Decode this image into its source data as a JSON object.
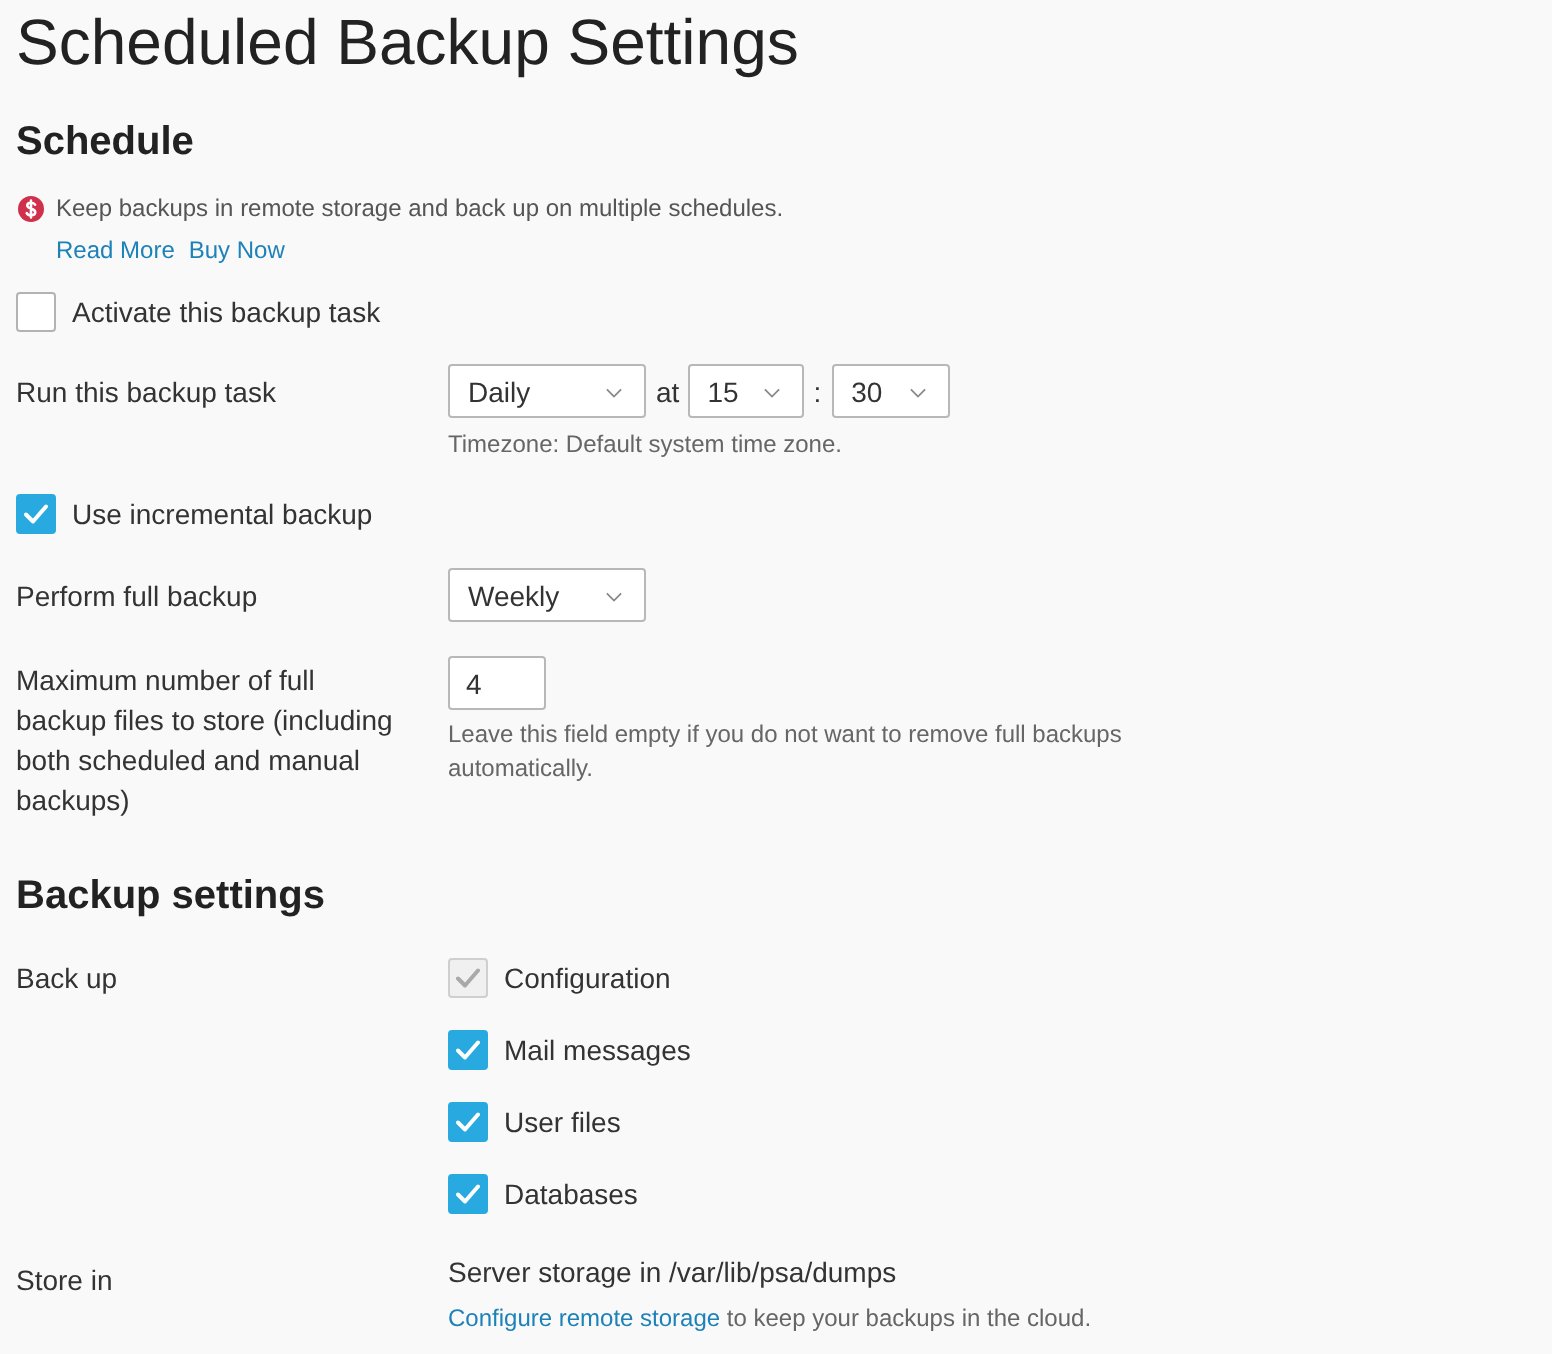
{
  "page_title": "Scheduled Backup Settings",
  "schedule": {
    "heading": "Schedule",
    "promo": {
      "text": "Keep backups in remote storage and back up on multiple schedules.",
      "links": [
        "Read More",
        "Buy Now"
      ]
    },
    "activate": {
      "label": "Activate this backup task",
      "checked": false
    },
    "run_task": {
      "label": "Run this backup task",
      "frequency": "Daily",
      "at_label": "at",
      "hour": "15",
      "separator": ":",
      "minute": "30",
      "hint": "Timezone: Default system time zone."
    },
    "incremental": {
      "label": "Use incremental backup",
      "checked": true
    },
    "full_backup": {
      "label": "Perform full backup",
      "value": "Weekly"
    },
    "max_files": {
      "label": "Maximum number of full backup files to store (including both scheduled and manual backups)",
      "value": "4",
      "hint": "Leave this field empty if you do not want to remove full backups automatically."
    }
  },
  "backup_settings": {
    "heading": "Backup settings",
    "back_up": {
      "label": "Back up",
      "options": [
        {
          "label": "Configuration",
          "checked": true,
          "disabled": true
        },
        {
          "label": "Mail messages",
          "checked": true,
          "disabled": false
        },
        {
          "label": "User files",
          "checked": true,
          "disabled": false
        },
        {
          "label": "Databases",
          "checked": true,
          "disabled": false
        }
      ]
    },
    "store_in": {
      "label": "Store in",
      "value": "Server storage in /var/lib/psa/dumps",
      "note": {
        "link": "Configure remote storage",
        "text": " to keep your backups in the cloud."
      }
    }
  }
}
